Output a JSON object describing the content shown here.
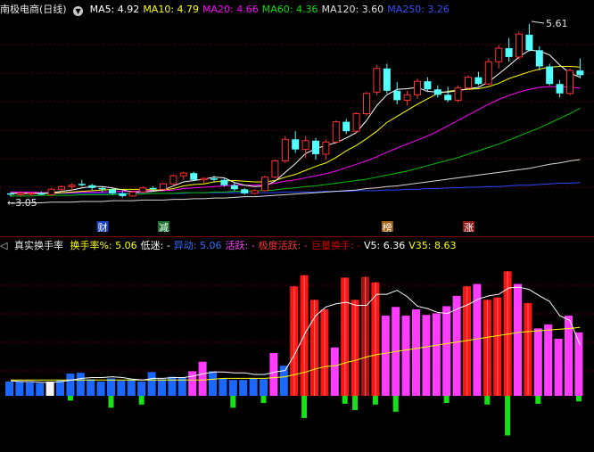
{
  "top": {
    "title": "南极电商(日线)",
    "menu_icon": "circle-chevron-down-icon",
    "ma": [
      {
        "label": "MA5: 4.92",
        "color": "#ffffff"
      },
      {
        "label": "MA10: 4.79",
        "color": "#ffff00"
      },
      {
        "label": "MA20: 4.66",
        "color": "#ff00ff"
      },
      {
        "label": "MA60: 4.36",
        "color": "#00e000"
      },
      {
        "label": "MA120: 3.60",
        "color": "#e0e0e0"
      },
      {
        "label": "MA250: 3.26",
        "color": "#3050ff"
      }
    ],
    "high_marker": "5.61",
    "low_marker": "3.05",
    "events": [
      {
        "label": "财",
        "bg": "#1840c0",
        "fg": "#ffffff"
      },
      {
        "label": "减",
        "bg": "#187030",
        "fg": "#ffffff"
      },
      {
        "label": "榜",
        "bg": "#a06018",
        "fg": "#ffffff"
      },
      {
        "label": "涨",
        "bg": "#901818",
        "fg": "#ffffff"
      }
    ]
  },
  "bottom": {
    "title": "真实换手率",
    "items": [
      {
        "label": "换手率%: 5.06",
        "color": "#ffff00"
      },
      {
        "label": "低迷: -",
        "color": "#ffffff"
      },
      {
        "label": "异动: 5.06",
        "color": "#3070ff"
      },
      {
        "label": "活跃: -",
        "color": "#ff40ff"
      },
      {
        "label": "极度活跃: -",
        "color": "#ff3030"
      },
      {
        "label": "巨量换手: -",
        "color": "#d00000"
      },
      {
        "label": "V5: 6.36",
        "color": "#ffffff"
      },
      {
        "label": "V35: 8.63",
        "color": "#ffff00"
      }
    ]
  },
  "chart_data": [
    {
      "type": "candlestick",
      "title": "南极电商(日线)",
      "low_label": 3.05,
      "high_label": 5.61,
      "candles": [
        [
          3.1,
          3.12,
          3.05,
          3.08
        ],
        [
          3.08,
          3.13,
          3.05,
          3.1
        ],
        [
          3.09,
          3.11,
          3.06,
          3.1
        ],
        [
          3.1,
          3.13,
          3.07,
          3.08
        ],
        [
          3.08,
          3.18,
          3.07,
          3.16
        ],
        [
          3.16,
          3.22,
          3.13,
          3.2
        ],
        [
          3.2,
          3.25,
          3.15,
          3.22
        ],
        [
          3.24,
          3.3,
          3.2,
          3.22
        ],
        [
          3.22,
          3.24,
          3.15,
          3.18
        ],
        [
          3.18,
          3.2,
          3.12,
          3.16
        ],
        [
          3.16,
          3.18,
          3.08,
          3.1
        ],
        [
          3.1,
          3.13,
          3.04,
          3.06
        ],
        [
          3.06,
          3.14,
          3.05,
          3.12
        ],
        [
          3.12,
          3.2,
          3.1,
          3.18
        ],
        [
          3.18,
          3.2,
          3.14,
          3.16
        ],
        [
          3.16,
          3.25,
          3.15,
          3.24
        ],
        [
          3.24,
          3.38,
          3.22,
          3.36
        ],
        [
          3.36,
          3.42,
          3.3,
          3.4
        ],
        [
          3.4,
          3.42,
          3.28,
          3.3
        ],
        [
          3.3,
          3.34,
          3.25,
          3.32
        ],
        [
          3.32,
          3.36,
          3.26,
          3.3
        ],
        [
          3.3,
          3.32,
          3.2,
          3.22
        ],
        [
          3.22,
          3.26,
          3.14,
          3.16
        ],
        [
          3.16,
          3.18,
          3.08,
          3.1
        ],
        [
          3.1,
          3.16,
          3.08,
          3.14
        ],
        [
          3.14,
          3.36,
          3.13,
          3.34
        ],
        [
          3.34,
          3.6,
          3.32,
          3.58
        ],
        [
          3.58,
          3.95,
          3.55,
          3.9
        ],
        [
          3.9,
          4.02,
          3.7,
          3.75
        ],
        [
          3.75,
          3.95,
          3.62,
          3.88
        ],
        [
          3.88,
          3.92,
          3.6,
          3.68
        ],
        [
          3.68,
          3.9,
          3.6,
          3.86
        ],
        [
          3.86,
          4.18,
          3.84,
          4.16
        ],
        [
          4.16,
          4.2,
          3.98,
          4.02
        ],
        [
          4.02,
          4.3,
          4.0,
          4.28
        ],
        [
          4.28,
          4.6,
          4.25,
          4.58
        ],
        [
          4.6,
          5.0,
          4.55,
          4.95
        ],
        [
          4.95,
          5.02,
          4.58,
          4.62
        ],
        [
          4.62,
          4.75,
          4.42,
          4.48
        ],
        [
          4.48,
          4.62,
          4.4,
          4.56
        ],
        [
          4.56,
          4.8,
          4.5,
          4.76
        ],
        [
          4.76,
          4.82,
          4.6,
          4.64
        ],
        [
          4.64,
          4.7,
          4.52,
          4.56
        ],
        [
          4.56,
          4.68,
          4.45,
          4.48
        ],
        [
          4.48,
          4.7,
          4.45,
          4.66
        ],
        [
          4.66,
          4.85,
          4.64,
          4.82
        ],
        [
          4.82,
          4.9,
          4.7,
          4.72
        ],
        [
          4.72,
          5.1,
          4.7,
          5.05
        ],
        [
          5.05,
          5.3,
          4.95,
          5.25
        ],
        [
          5.25,
          5.4,
          5.05,
          5.12
        ],
        [
          5.12,
          5.5,
          5.08,
          5.46
        ],
        [
          5.45,
          5.61,
          5.2,
          5.22
        ],
        [
          5.22,
          5.28,
          4.92,
          4.98
        ],
        [
          4.98,
          5.02,
          4.7,
          4.72
        ],
        [
          4.72,
          4.78,
          4.52,
          4.58
        ],
        [
          4.58,
          4.95,
          4.55,
          4.92
        ],
        [
          4.92,
          5.1,
          4.8,
          4.85
        ]
      ],
      "ma5": [
        3.1,
        3.1,
        3.1,
        3.1,
        3.11,
        3.13,
        3.15,
        3.18,
        3.2,
        3.2,
        3.18,
        3.15,
        3.12,
        3.12,
        3.13,
        3.15,
        3.21,
        3.27,
        3.29,
        3.31,
        3.34,
        3.33,
        3.26,
        3.22,
        3.2,
        3.21,
        3.28,
        3.41,
        3.54,
        3.69,
        3.76,
        3.81,
        3.85,
        3.92,
        4.0,
        4.18,
        4.4,
        4.56,
        4.64,
        4.65,
        4.67,
        4.61,
        4.6,
        4.6,
        4.62,
        4.65,
        4.67,
        4.75,
        4.87,
        4.99,
        5.12,
        5.22,
        5.21,
        5.15,
        5.0,
        4.88,
        4.82
      ],
      "ma10": [
        3.1,
        3.1,
        3.1,
        3.1,
        3.1,
        3.11,
        3.12,
        3.13,
        3.14,
        3.15,
        3.16,
        3.16,
        3.16,
        3.16,
        3.15,
        3.15,
        3.17,
        3.21,
        3.23,
        3.24,
        3.27,
        3.28,
        3.29,
        3.28,
        3.27,
        3.27,
        3.29,
        3.34,
        3.38,
        3.44,
        3.5,
        3.55,
        3.63,
        3.73,
        3.81,
        3.91,
        4.02,
        4.15,
        4.24,
        4.33,
        4.42,
        4.5,
        4.58,
        4.61,
        4.63,
        4.64,
        4.65,
        4.68,
        4.73,
        4.8,
        4.85,
        4.9,
        4.94,
        4.97,
        4.98,
        4.98,
        4.97
      ],
      "ma20": [
        3.12,
        3.12,
        3.12,
        3.11,
        3.11,
        3.11,
        3.11,
        3.12,
        3.12,
        3.12,
        3.13,
        3.13,
        3.13,
        3.14,
        3.14,
        3.14,
        3.15,
        3.17,
        3.18,
        3.19,
        3.2,
        3.21,
        3.22,
        3.22,
        3.22,
        3.23,
        3.25,
        3.28,
        3.3,
        3.33,
        3.36,
        3.39,
        3.43,
        3.48,
        3.53,
        3.58,
        3.64,
        3.71,
        3.77,
        3.83,
        3.89,
        3.95,
        4.02,
        4.1,
        4.18,
        4.26,
        4.34,
        4.42,
        4.49,
        4.55,
        4.6,
        4.64,
        4.67,
        4.68,
        4.68,
        4.67,
        4.66
      ],
      "ma60": [
        3.06,
        3.06,
        3.06,
        3.07,
        3.07,
        3.07,
        3.07,
        3.08,
        3.08,
        3.08,
        3.08,
        3.09,
        3.09,
        3.09,
        3.1,
        3.1,
        3.1,
        3.11,
        3.11,
        3.11,
        3.12,
        3.12,
        3.13,
        3.13,
        3.14,
        3.14,
        3.15,
        3.17,
        3.18,
        3.2,
        3.21,
        3.23,
        3.25,
        3.27,
        3.29,
        3.31,
        3.34,
        3.37,
        3.4,
        3.43,
        3.47,
        3.51,
        3.55,
        3.59,
        3.63,
        3.68,
        3.73,
        3.78,
        3.83,
        3.89,
        3.95,
        4.01,
        4.07,
        4.14,
        4.21,
        4.28,
        4.36
      ],
      "ma120": [
        2.95,
        2.96,
        2.96,
        2.96,
        2.97,
        2.97,
        2.97,
        2.98,
        2.98,
        2.98,
        2.99,
        2.99,
        2.99,
        3.0,
        3.0,
        3.0,
        3.01,
        3.01,
        3.02,
        3.02,
        3.03,
        3.03,
        3.04,
        3.05,
        3.05,
        3.06,
        3.07,
        3.08,
        3.09,
        3.1,
        3.11,
        3.12,
        3.13,
        3.14,
        3.15,
        3.17,
        3.18,
        3.2,
        3.21,
        3.23,
        3.25,
        3.27,
        3.29,
        3.31,
        3.33,
        3.35,
        3.37,
        3.39,
        3.41,
        3.43,
        3.45,
        3.47,
        3.5,
        3.53,
        3.55,
        3.58,
        3.6
      ],
      "ma250": [
        3.1,
        3.1,
        3.1,
        3.1,
        3.1,
        3.1,
        3.1,
        3.1,
        3.1,
        3.1,
        3.1,
        3.1,
        3.1,
        3.1,
        3.1,
        3.1,
        3.1,
        3.1,
        3.11,
        3.11,
        3.11,
        3.11,
        3.11,
        3.11,
        3.11,
        3.11,
        3.11,
        3.12,
        3.12,
        3.12,
        3.12,
        3.13,
        3.13,
        3.13,
        3.14,
        3.14,
        3.14,
        3.15,
        3.15,
        3.16,
        3.16,
        3.17,
        3.17,
        3.18,
        3.18,
        3.19,
        3.19,
        3.2,
        3.2,
        3.21,
        3.22,
        3.22,
        3.23,
        3.24,
        3.25,
        3.25,
        3.26
      ],
      "event_candle_index": [
        9,
        15,
        37,
        45
      ]
    },
    {
      "type": "bar",
      "title": "真实换手率",
      "turnover": [
        1.8,
        1.8,
        1.7,
        1.6,
        1.8,
        2.0,
        2.8,
        2.9,
        2.1,
        1.8,
        2.2,
        1.9,
        2.1,
        1.8,
        3.0,
        2.1,
        2.4,
        2.3,
        3.1,
        4.3,
        3.1,
        2.2,
        2.0,
        2.0,
        2.2,
        2.1,
        5.4,
        3.8,
        13.8,
        15.2,
        12.1,
        10.9,
        6.1,
        14.9,
        12.1,
        15.0,
        14.3,
        10.1,
        11.2,
        10.1,
        10.9,
        10.2,
        10.4,
        11.3,
        12.6,
        13.8,
        14.1,
        12.1,
        12.4,
        15.7,
        14.1,
        11.7,
        8.5,
        9.0,
        7.2,
        10.1,
        8.0
      ],
      "color_class": [
        "b",
        "b",
        "b",
        "b",
        "w",
        "b",
        "b",
        "b",
        "b",
        "b",
        "b",
        "b",
        "b",
        "b",
        "b",
        "b",
        "b",
        "b",
        "m",
        "m",
        "b",
        "b",
        "b",
        "b",
        "b",
        "b",
        "m",
        "b",
        "r",
        "r",
        "r",
        "r",
        "m",
        "r",
        "r",
        "d",
        "r",
        "m",
        "m",
        "m",
        "m",
        "m",
        "m",
        "m",
        "m",
        "r",
        "m",
        "r",
        "r",
        "r",
        "m",
        "r",
        "m",
        "m",
        "m",
        "m",
        "m"
      ],
      "neg": [
        0,
        0,
        0,
        0,
        0,
        0,
        0,
        0,
        0,
        0,
        0,
        0,
        0,
        0,
        0,
        0,
        0,
        0,
        0,
        0,
        0,
        0,
        0,
        0,
        0,
        0,
        0,
        0,
        0,
        0,
        0,
        0,
        0,
        0,
        0,
        0,
        0,
        0,
        0,
        0,
        0,
        0,
        0,
        0,
        0,
        0,
        0,
        0,
        0,
        0,
        0,
        0,
        0,
        0,
        0,
        0,
        0
      ],
      "neg_bars": [
        {
          "i": 6,
          "v": 0.6
        },
        {
          "i": 10,
          "v": 1.5
        },
        {
          "i": 13,
          "v": 1.1
        },
        {
          "i": 22,
          "v": 1.5
        },
        {
          "i": 25,
          "v": 0.9
        },
        {
          "i": 29,
          "v": 2.8
        },
        {
          "i": 33,
          "v": 1.0
        },
        {
          "i": 34,
          "v": 1.8
        },
        {
          "i": 36,
          "v": 1.1
        },
        {
          "i": 38,
          "v": 2.0
        },
        {
          "i": 43,
          "v": 0.9
        },
        {
          "i": 47,
          "v": 1.1
        },
        {
          "i": 49,
          "v": 5.0
        },
        {
          "i": 52,
          "v": 1.0
        },
        {
          "i": 56,
          "v": 0.7
        }
      ],
      "v5": [
        1.9,
        1.8,
        1.8,
        1.7,
        1.7,
        1.8,
        2.0,
        2.2,
        2.3,
        2.3,
        2.4,
        2.3,
        2.1,
        2.0,
        2.2,
        2.2,
        2.3,
        2.3,
        2.5,
        2.8,
        3.0,
        3.0,
        2.9,
        2.9,
        2.7,
        2.7,
        3.0,
        3.2,
        5.4,
        8.0,
        10.1,
        11.2,
        11.6,
        11.8,
        11.4,
        11.4,
        12.8,
        12.8,
        13.3,
        12.5,
        11.3,
        11.0,
        10.5,
        10.4,
        11.0,
        11.5,
        12.2,
        12.6,
        12.8,
        13.6,
        13.7,
        13.4,
        12.6,
        11.9,
        10.1,
        9.5,
        6.4
      ],
      "v35": [
        2.0,
        2.0,
        2.0,
        2.0,
        2.0,
        2.0,
        2.0,
        2.0,
        2.0,
        2.0,
        2.0,
        2.0,
        2.0,
        2.0,
        2.0,
        2.0,
        2.0,
        2.0,
        2.0,
        2.0,
        2.1,
        2.2,
        2.2,
        2.2,
        2.2,
        2.2,
        2.3,
        2.4,
        2.7,
        3.0,
        3.4,
        3.7,
        3.8,
        4.2,
        4.5,
        4.9,
        5.2,
        5.4,
        5.6,
        5.8,
        6.0,
        6.2,
        6.4,
        6.6,
        6.8,
        7.0,
        7.2,
        7.4,
        7.6,
        7.8,
        8.0,
        8.1,
        8.2,
        8.3,
        8.4,
        8.5,
        8.63
      ]
    }
  ]
}
